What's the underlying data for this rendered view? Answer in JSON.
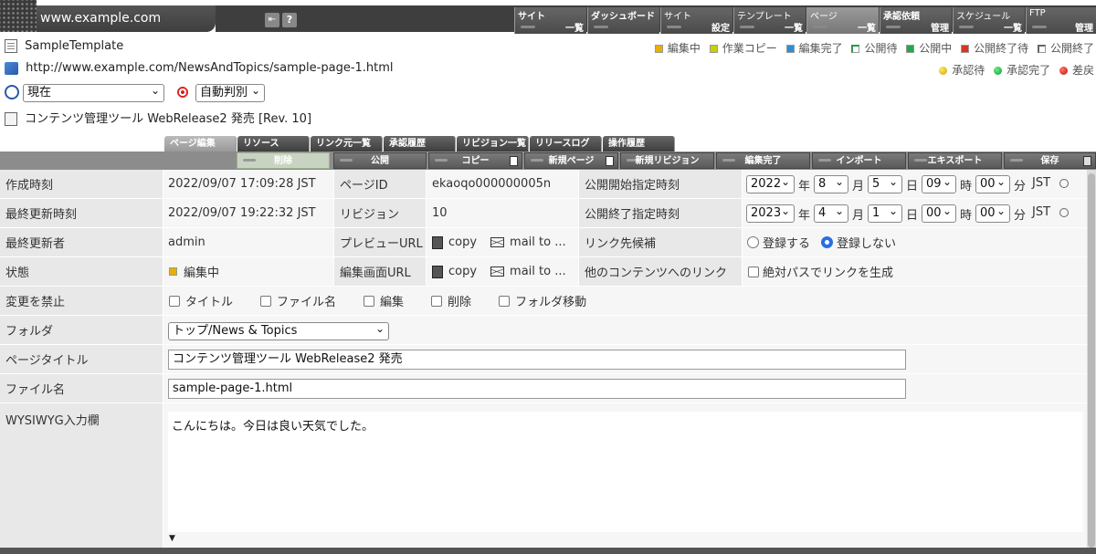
{
  "header": {
    "host": "www.example.com",
    "nav": [
      {
        "l1": "サイト",
        "l2": "一覧"
      },
      {
        "l1": "ダッシュボード",
        "l2": ""
      },
      {
        "l1": "サイト",
        "l2": "設定"
      },
      {
        "l1": "テンプレート",
        "l2": "一覧"
      },
      {
        "l1": "ページ",
        "l2": "一覧"
      },
      {
        "l1": "承認依頼",
        "l2": "管理"
      },
      {
        "l1": "スケジュール",
        "l2": "一覧"
      },
      {
        "l1": "FTP",
        "l2": "管理"
      }
    ]
  },
  "info": {
    "template": "SampleTemplate",
    "url": "http://www.example.com/NewsAndTopics/sample-page-1.html",
    "time_select": "現在",
    "auto_select": "自動判別",
    "page_title_rev": "コンテンツ管理ツール WebRelease2 発売 [Rev. 10]"
  },
  "legend1": [
    {
      "label": "編集中",
      "color": "#e8b000"
    },
    {
      "label": "作業コピー",
      "color": "#c8d000"
    },
    {
      "label": "編集完了",
      "color": "#2a8fd8"
    },
    {
      "label": "公開待",
      "color": "#2a9a4a"
    },
    {
      "label": "公開中",
      "color": "#22aa44"
    },
    {
      "label": "公開終了待",
      "color": "#dd3322"
    },
    {
      "label": "公開終了",
      "color": "#ffffff"
    }
  ],
  "legend2": [
    {
      "label": "承認待",
      "color": "#d8c400"
    },
    {
      "label": "承認完了",
      "color": "#22aa44"
    },
    {
      "label": "差戻",
      "color": "#cc2222"
    }
  ],
  "tabs": [
    "ページ編集",
    "リソース",
    "リンク元一覧",
    "承認履歴",
    "リビジョン一覧",
    "リリースログ",
    "操作履歴"
  ],
  "toolbar": [
    "削除",
    "公開",
    "コピー",
    "新規ページ",
    "新規リビジョン",
    "編集完了",
    "インポート",
    "エキスポート",
    "保存"
  ],
  "form": {
    "created_label": "作成時刻",
    "created_value": "2022/09/07 17:09:28 JST",
    "pageid_label": "ページID",
    "pageid_value": "ekaoqo000000005n",
    "pub_start_label": "公開開始指定時刻",
    "pub_start": {
      "year": "2022",
      "month": "8",
      "day": "5",
      "hour": "09",
      "min": "00"
    },
    "updated_label": "最終更新時刻",
    "updated_value": "2022/09/07 19:22:32 JST",
    "rev_label": "リビジョン",
    "rev_value": "10",
    "pub_end_label": "公開終了指定時刻",
    "pub_end": {
      "year": "2023",
      "month": "4",
      "day": "1",
      "hour": "00",
      "min": "00"
    },
    "unit_year": "年",
    "unit_month": "月",
    "unit_day": "日",
    "unit_hour": "時",
    "unit_min": "分",
    "tz": "JST",
    "updater_label": "最終更新者",
    "updater_value": "admin",
    "preview_label": "プレビューURL",
    "copy_label": "copy",
    "mailto_label": "mail to ...",
    "link_cand_label": "リンク先候補",
    "register_yes": "登録する",
    "register_no": "登録しない",
    "status_label": "状態",
    "status_value": "編集中",
    "editurl_label": "編集画面URL",
    "otherlink_label": "他のコンテンツへのリンク",
    "abs_path_label": "絶対パスでリンクを生成",
    "lock_label": "変更を禁止",
    "lock_opts": [
      "タイトル",
      "ファイル名",
      "編集",
      "削除",
      "フォルダ移動"
    ],
    "folder_label": "フォルダ",
    "folder_value": "トップ/News & Topics",
    "title_label": "ページタイトル",
    "title_value": "コンテンツ管理ツール WebRelease2 発売",
    "filename_label": "ファイル名",
    "filename_value": "sample-page-1.html",
    "wysiwyg_label": "WYSIWYG入力欄",
    "wysiwyg_value": "こんにちは。今日は良い天気でした。"
  }
}
